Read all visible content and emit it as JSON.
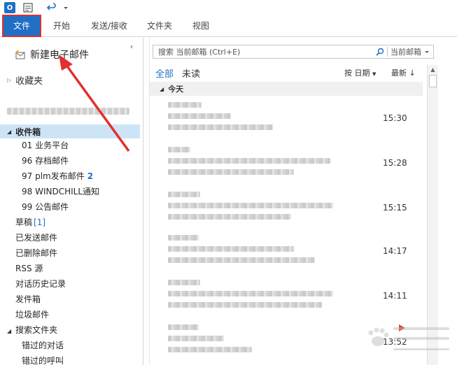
{
  "ribbon": {
    "tabs": [
      {
        "label": "文件"
      },
      {
        "label": "开始"
      },
      {
        "label": "发送/接收"
      },
      {
        "label": "文件夹"
      },
      {
        "label": "视图"
      }
    ]
  },
  "folder_pane": {
    "new_mail": "新建电子邮件",
    "favorites": "收藏夹",
    "inbox": "收件箱",
    "inbox_subfolders": [
      {
        "label": "01 业务平台",
        "count": ""
      },
      {
        "label": "96 存档邮件",
        "count": ""
      },
      {
        "label": "97 plm发布邮件",
        "count": "2"
      },
      {
        "label": "98 WINDCHILL通知",
        "count": ""
      },
      {
        "label": "99 公告邮件",
        "count": ""
      }
    ],
    "folders": [
      {
        "label": "草稿",
        "count": "[1]"
      },
      {
        "label": "已发送邮件",
        "count": ""
      },
      {
        "label": "已删除邮件",
        "count": ""
      },
      {
        "label": "RSS 源",
        "count": ""
      },
      {
        "label": "对话历史记录",
        "count": ""
      },
      {
        "label": "发件箱",
        "count": ""
      },
      {
        "label": "垃圾邮件",
        "count": ""
      },
      {
        "label": "搜索文件夹",
        "count": ""
      }
    ],
    "search_subfolders": [
      {
        "label": "错过的对话"
      },
      {
        "label": "错过的呼叫"
      }
    ]
  },
  "message_list": {
    "search_placeholder": "搜索 当前邮箱 (Ctrl+E)",
    "search_scope": "当前邮箱",
    "filter_all": "全部",
    "filter_unread": "未读",
    "sort_by": "按 日期",
    "sort_order": "最新",
    "group_today": "今天",
    "messages": [
      {
        "time": "15:30",
        "flagged": false
      },
      {
        "time": "15:28",
        "flagged": false
      },
      {
        "time": "15:15",
        "flagged": false
      },
      {
        "time": "14:17",
        "flagged": false
      },
      {
        "time": "14:11",
        "flagged": false
      },
      {
        "time": "13:52",
        "flagged": true
      }
    ]
  },
  "colors": {
    "accent": "#1f6fc5",
    "selection": "#cde4f7",
    "annotation": "#e03030",
    "flag": "#d9472b"
  }
}
